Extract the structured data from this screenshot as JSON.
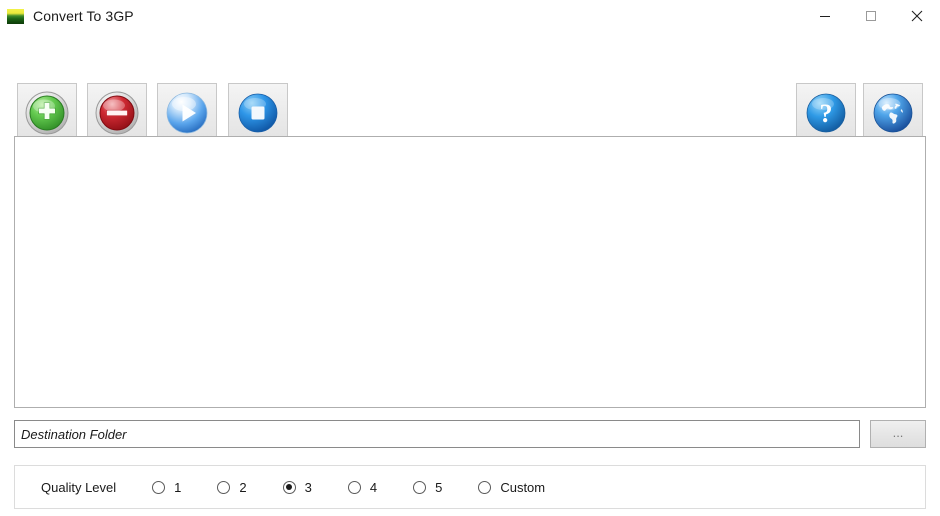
{
  "window": {
    "title": "Convert To 3GP",
    "icon": "app-gradient-icon",
    "controls": {
      "minimize": "–",
      "maximize": "□",
      "close": "×"
    }
  },
  "toolbar": {
    "buttons": [
      {
        "name": "add-files-button",
        "icon": "green-plus-icon",
        "label": "Add"
      },
      {
        "name": "remove-files-button",
        "icon": "red-minus-icon",
        "label": "Remove"
      },
      {
        "name": "start-conversion-button",
        "icon": "blue-play-icon",
        "label": "Start"
      },
      {
        "name": "stop-conversion-button",
        "icon": "blue-stop-icon",
        "label": "Stop"
      }
    ],
    "right_buttons": [
      {
        "name": "help-button",
        "icon": "blue-question-mark-icon",
        "label": "Help"
      },
      {
        "name": "website-button",
        "icon": "globe-icon",
        "label": "Website"
      }
    ]
  },
  "file_list": {
    "items": [],
    "empty": true
  },
  "destination": {
    "placeholder": "Destination Folder",
    "value": "",
    "browse_label": "..."
  },
  "quality": {
    "label": "Quality Level",
    "selected": "3",
    "options": [
      {
        "value": "1",
        "label": "1"
      },
      {
        "value": "2",
        "label": "2"
      },
      {
        "value": "3",
        "label": "3"
      },
      {
        "value": "4",
        "label": "4"
      },
      {
        "value": "5",
        "label": "5"
      },
      {
        "value": "custom",
        "label": "Custom"
      }
    ]
  },
  "colors": {
    "accent_green": "#3fae3f",
    "accent_red": "#c0202a",
    "accent_blue": "#2f8fe0",
    "window_bg": "#ffffff",
    "border": "#aeaeae"
  }
}
